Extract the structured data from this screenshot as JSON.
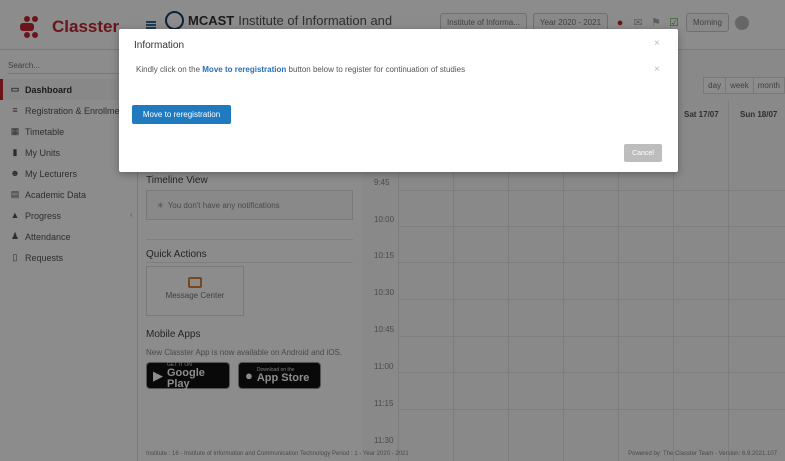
{
  "app": {
    "name": "Classter",
    "brand_color": "#c4262e"
  },
  "header": {
    "institution_prefix": "MCAST",
    "institution_rest": "Institute of Information and",
    "institute_dropdown": "Institute of Informa...",
    "year_dropdown": "Year 2020 - 2021",
    "user_greeting": "Morning"
  },
  "sidebar": {
    "search_placeholder": "Search...",
    "items": [
      {
        "label": "Dashboard",
        "icon": "monitor-icon",
        "active": true
      },
      {
        "label": "Registration & Enrollme",
        "icon": "registration-icon"
      },
      {
        "label": "Timetable",
        "icon": "timetable-icon"
      },
      {
        "label": "My Units",
        "icon": "units-icon"
      },
      {
        "label": "My Lecturers",
        "icon": "lecturers-icon"
      },
      {
        "label": "Academic Data",
        "icon": "academic-data-icon"
      },
      {
        "label": "Progress",
        "icon": "progress-icon"
      },
      {
        "label": "Attendance",
        "icon": "attendance-icon"
      },
      {
        "label": "Requests",
        "icon": "requests-icon"
      }
    ]
  },
  "dashboard": {
    "timeline_title": "Timeline View",
    "no_notifications": "You don't have any notifications",
    "quick_actions_title": "Quick Actions",
    "message_center": "Message Center",
    "mobile_apps_title": "Mobile Apps",
    "mobile_apps_text": "New Classter App is now available on Android and iOS.",
    "google_small": "GET IT ON",
    "google_big": "Google Play",
    "apple_small": "Download on the",
    "apple_big": "App Store"
  },
  "calendar": {
    "views": [
      "day",
      "week",
      "month"
    ],
    "day_headers": [
      "Sat 17/07",
      "Sun 18/07"
    ],
    "times": [
      "9:45",
      "10:00",
      "10:15",
      "10:30",
      "10:45",
      "11:00",
      "11:15",
      "11:30"
    ]
  },
  "footer": {
    "left": "Institute : 16 - Institute of Information and Communication Technology Period : 1 - Year 2020 - 2021",
    "right": "Powered by: The Classter Team  - Version: 6.9.2021.107"
  },
  "modal": {
    "title": "Information",
    "message_before": "Kindly click on the",
    "message_link": "Move to reregistration",
    "message_after": "button below to register for continuation of studies",
    "primary_button": "Move to reregistration",
    "cancel_button": "Cancel"
  }
}
